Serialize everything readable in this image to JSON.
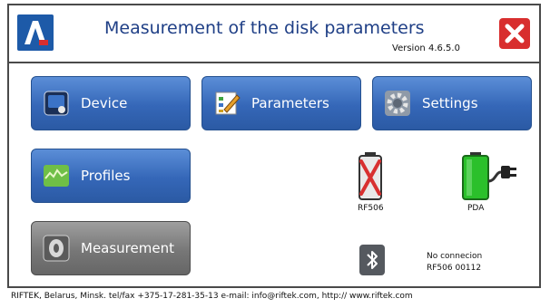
{
  "header": {
    "title": "Measurement of the disk parameters",
    "version": "Version 4.6.5.0"
  },
  "buttons": {
    "device": "Device",
    "parameters": "Parameters",
    "settings": "Settings",
    "profiles": "Profiles",
    "measurement": "Measurement"
  },
  "status": {
    "sensor_label": "RF506",
    "pda_label": "PDA",
    "bt_line1": "No connecion",
    "bt_line2": "RF506 00112"
  },
  "footer": {
    "text": "RIFTEK, Belarus, Minsk.  tel/fax +375-17-281-35-13  e-mail: info@riftek.com, http:// www.riftek.com"
  },
  "icons": {
    "logo": "app-logo-icon",
    "close": "close-icon",
    "device": "device-icon",
    "parameters": "parameters-icon",
    "settings": "settings-gear-icon",
    "profiles": "profiles-icon",
    "measurement": "measurement-icon",
    "sensor_status": "battery-disconnected-icon",
    "pda_status": "battery-charging-icon",
    "bluetooth": "bluetooth-icon"
  },
  "colors": {
    "accent": "#1d5aa8",
    "button_blue": "#3567b8",
    "button_gray": "#777777",
    "close_red": "#d82e2e",
    "battery_green": "#2bc02b"
  }
}
